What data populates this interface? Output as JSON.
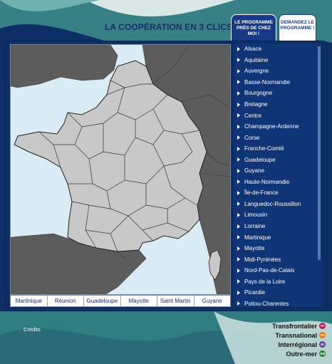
{
  "header": {
    "title": "LA COOPÉRATION EN 3 CLICS"
  },
  "tabs": [
    {
      "label": "LE PROGRAMME PRÈS DE CHEZ MOI !"
    },
    {
      "label": "DEMANDEZ LE PROGRAMME !"
    }
  ],
  "regions": [
    "Alsace",
    "Aquitaine",
    "Auvergne",
    "Basse-Normandie",
    "Bourgogne",
    "Bretagne",
    "Centre",
    "Champagne-Ardenne",
    "Corse",
    "Franche-Comté",
    "Guadeloupe",
    "Guyane",
    "Haute-Normandie",
    "Île-de-France",
    "Languedoc-Roussillon",
    "Limousin",
    "Lorraine",
    "Martinique",
    "Mayotte",
    "Midi-Pyrénées",
    "Nord-Pas-de-Calais",
    "Pays de la Loire",
    "Picardie",
    "Poitou-Charentes"
  ],
  "overseas_tabs": [
    "Martinique",
    "Réunion",
    "Guadeloupe",
    "Mayotte",
    "Saint Martin",
    "Guyane"
  ],
  "footer": {
    "credits": "Crédits"
  },
  "legend": [
    {
      "label": "Transfrontalier",
      "code": "TF",
      "color": "#c2185b"
    },
    {
      "label": "Transnational",
      "code": "TN",
      "color": "#e07a10"
    },
    {
      "label": "Interrégional",
      "code": "IR",
      "color": "#6a3d9a"
    },
    {
      "label": "Outre-mer",
      "code": "OM",
      "color": "#2e7d32"
    }
  ],
  "colors": {
    "background": "#0d2f66",
    "sea": "#d9ecf5",
    "france_regions": "#c8c8c8",
    "neighbors": "#5c5c5c"
  }
}
